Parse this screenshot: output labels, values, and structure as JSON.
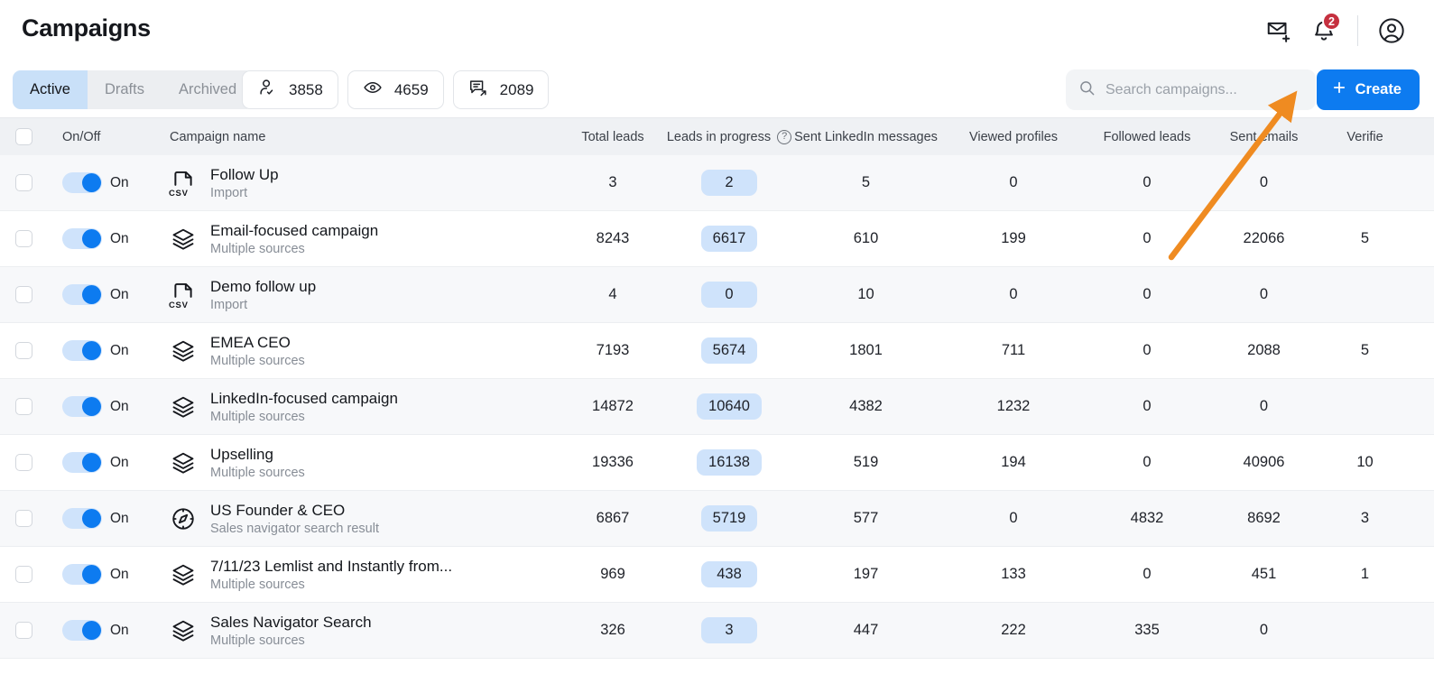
{
  "header": {
    "title": "Campaigns",
    "icons": [
      {
        "name": "mail-add-icon",
        "label": "New message"
      },
      {
        "name": "bell-icon",
        "label": "Notifications",
        "badge": "2"
      },
      {
        "name": "account-icon",
        "label": "Account"
      }
    ]
  },
  "toolbar": {
    "tabs": [
      {
        "label": "Active",
        "active": true
      },
      {
        "label": "Drafts",
        "active": false
      },
      {
        "label": "Archived",
        "active": false
      }
    ],
    "stats": [
      {
        "icon": "user-check-icon",
        "value": "3858"
      },
      {
        "icon": "eye-icon",
        "value": "4659"
      },
      {
        "icon": "message-sent-icon",
        "value": "2089"
      }
    ],
    "search": {
      "placeholder": "Search campaigns...",
      "value": ""
    },
    "create_label": "Create"
  },
  "table": {
    "columns": [
      "On/Off",
      "Campaign name",
      "Total leads",
      "Leads in progress",
      "Sent LinkedIn messages",
      "Viewed profiles",
      "Followed leads",
      "Sent emails",
      "Verifie"
    ],
    "rows": [
      {
        "toggle": "On",
        "name": "Follow Up",
        "source": "Import",
        "source_icon": "csv-file-icon",
        "total_leads": "3",
        "leads_in_progress": "2",
        "sent_linkedin_messages": "5",
        "viewed_profiles": "0",
        "followed_leads": "0",
        "sent_emails": "0",
        "verified": ""
      },
      {
        "toggle": "On",
        "name": "Email-focused campaign",
        "source": "Multiple sources",
        "source_icon": "layers-icon",
        "total_leads": "8243",
        "leads_in_progress": "6617",
        "sent_linkedin_messages": "610",
        "viewed_profiles": "199",
        "followed_leads": "0",
        "sent_emails": "22066",
        "verified": "5"
      },
      {
        "toggle": "On",
        "name": "Demo follow up",
        "source": "Import",
        "source_icon": "csv-file-icon",
        "total_leads": "4",
        "leads_in_progress": "0",
        "sent_linkedin_messages": "10",
        "viewed_profiles": "0",
        "followed_leads": "0",
        "sent_emails": "0",
        "verified": ""
      },
      {
        "toggle": "On",
        "name": "EMEA CEO",
        "source": "Multiple sources",
        "source_icon": "layers-icon",
        "total_leads": "7193",
        "leads_in_progress": "5674",
        "sent_linkedin_messages": "1801",
        "viewed_profiles": "711",
        "followed_leads": "0",
        "sent_emails": "2088",
        "verified": "5"
      },
      {
        "toggle": "On",
        "name": "LinkedIn-focused campaign",
        "source": "Multiple sources",
        "source_icon": "layers-icon",
        "total_leads": "14872",
        "leads_in_progress": "10640",
        "sent_linkedin_messages": "4382",
        "viewed_profiles": "1232",
        "followed_leads": "0",
        "sent_emails": "0",
        "verified": ""
      },
      {
        "toggle": "On",
        "name": "Upselling",
        "source": "Multiple sources",
        "source_icon": "layers-icon",
        "total_leads": "19336",
        "leads_in_progress": "16138",
        "sent_linkedin_messages": "519",
        "viewed_profiles": "194",
        "followed_leads": "0",
        "sent_emails": "40906",
        "verified": "10"
      },
      {
        "toggle": "On",
        "name": "US Founder & CEO",
        "source": "Sales navigator search result",
        "source_icon": "compass-icon",
        "total_leads": "6867",
        "leads_in_progress": "5719",
        "sent_linkedin_messages": "577",
        "viewed_profiles": "0",
        "followed_leads": "4832",
        "sent_emails": "8692",
        "verified": "3"
      },
      {
        "toggle": "On",
        "name": "7/11/23 Lemlist and Instantly from...",
        "source": "Multiple sources",
        "source_icon": "layers-icon",
        "total_leads": "969",
        "leads_in_progress": "438",
        "sent_linkedin_messages": "197",
        "viewed_profiles": "133",
        "followed_leads": "0",
        "sent_emails": "451",
        "verified": "1"
      },
      {
        "toggle": "On",
        "name": "Sales Navigator Search",
        "source": "Multiple sources",
        "source_icon": "layers-icon",
        "total_leads": "326",
        "leads_in_progress": "3",
        "sent_linkedin_messages": "447",
        "viewed_profiles": "222",
        "followed_leads": "335",
        "sent_emails": "0",
        "verified": ""
      }
    ]
  },
  "annotation": {
    "arrow_color": "#ef8b21",
    "points_to": "create-button"
  },
  "colors": {
    "accent": "#0d7bf0",
    "badge_red": "#c5303f",
    "pill_blue": "#cfe3fb",
    "tab_active": "#c9e0f8",
    "row_stripe": "#f7f8fa",
    "header_bg": "#eff1f4"
  }
}
